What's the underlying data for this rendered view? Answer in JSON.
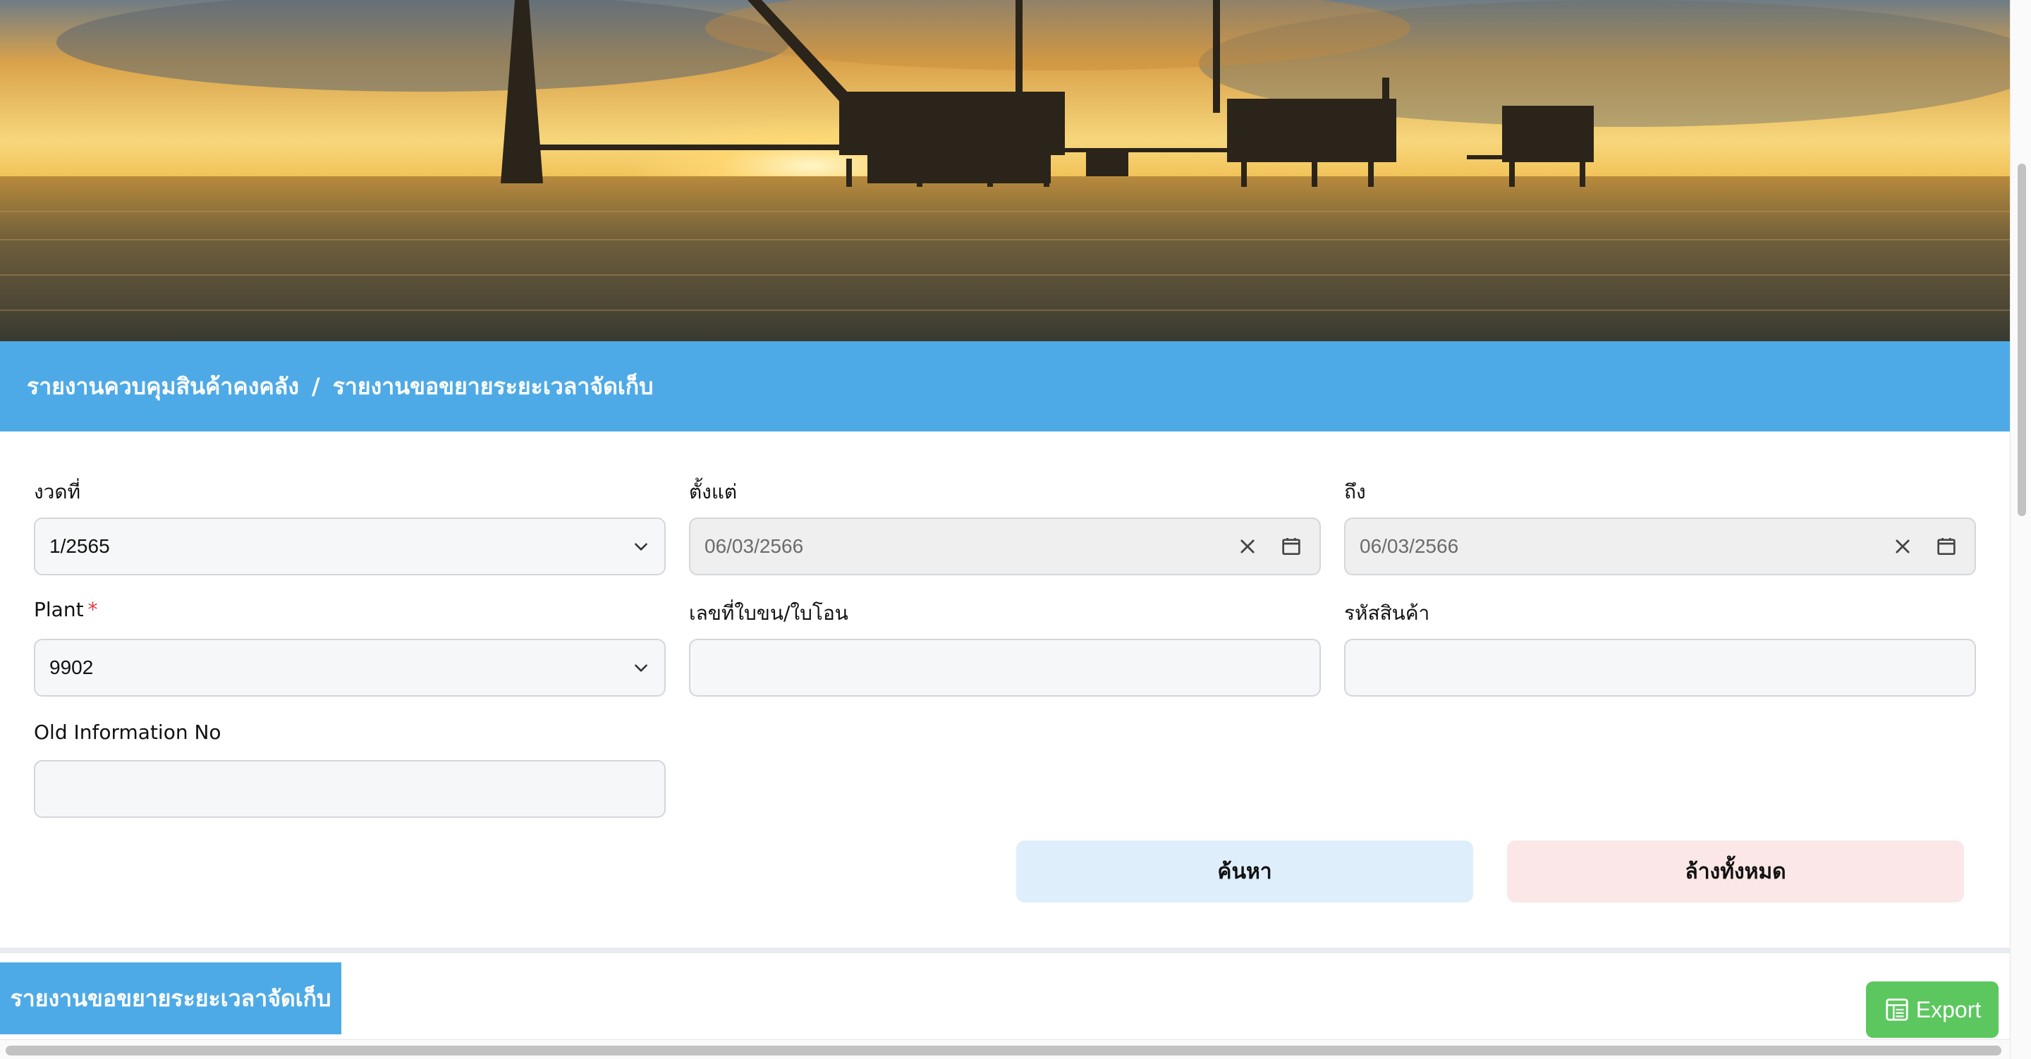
{
  "breadcrumb": {
    "parent": "รายงานควบคุมสินค้าคงคลัง",
    "separator": "/",
    "current": "รายงานขอขยายระยะเวลาจัดเก็บ"
  },
  "form": {
    "period": {
      "label": "งวดที่",
      "value": "1/2565"
    },
    "date_from": {
      "label": "ตั้งแต่",
      "value": "06/03/2566"
    },
    "date_to": {
      "label": "ถึง",
      "value": "06/03/2566"
    },
    "plant": {
      "label": "Plant",
      "required_mark": "*",
      "value": "9902"
    },
    "transport_doc_no": {
      "label": "เลขที่ใบขน/ใบโอน",
      "value": ""
    },
    "product_code": {
      "label": "รหัสสินค้า",
      "value": ""
    },
    "old_info_no": {
      "label": "Old Information No",
      "value": ""
    }
  },
  "actions": {
    "search_label": "ค้นหา",
    "clear_label": "ล้างทั้งหมด"
  },
  "report_tab": {
    "label": "รายงานขอขยายระยะเวลาจัดเก็บ"
  },
  "export": {
    "label": "Export",
    "icon": "spreadsheet-icon"
  },
  "colors": {
    "accent": "#4eaae6",
    "search_bg": "#dfeefb",
    "clear_bg": "#fbe7e7",
    "export_bg": "#5cc75e",
    "required": "#e03b3b"
  }
}
